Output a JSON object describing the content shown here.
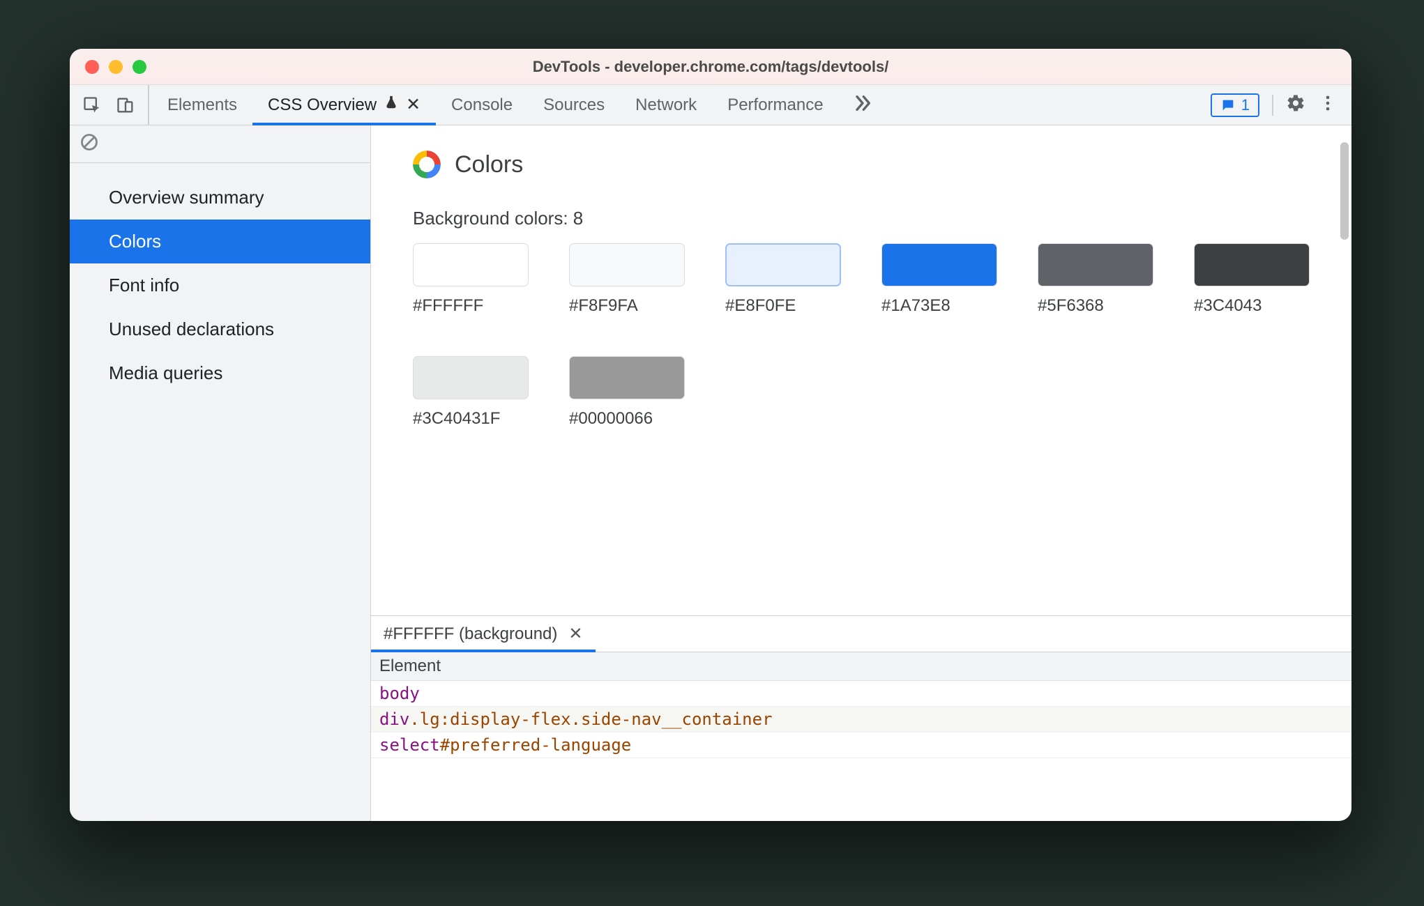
{
  "window_title": "DevTools - developer.chrome.com/tags/devtools/",
  "tabs": {
    "items": [
      "Elements",
      "CSS Overview",
      "Console",
      "Sources",
      "Network",
      "Performance"
    ],
    "active_index": 1,
    "experiment_on_index": 1,
    "close_on_active": true
  },
  "issues_count": "1",
  "sidebar": {
    "items": [
      "Overview summary",
      "Colors",
      "Font info",
      "Unused declarations",
      "Media queries"
    ],
    "selected_index": 1
  },
  "colors_section": {
    "title": "Colors",
    "background_label": "Background colors: 8",
    "swatches": [
      {
        "hex": "#FFFFFF",
        "fill": "#FFFFFF"
      },
      {
        "hex": "#F8F9FA",
        "fill": "#F8F9FA"
      },
      {
        "hex": "#E8F0FE",
        "fill": "#E8F0FE"
      },
      {
        "hex": "#1A73E8",
        "fill": "#1A73E8"
      },
      {
        "hex": "#5F6368",
        "fill": "#5F6368"
      },
      {
        "hex": "#3C4043",
        "fill": "#3C4043"
      },
      {
        "hex": "#3C40431F",
        "fill": "rgba(60,64,67,0.12)"
      },
      {
        "hex": "#00000066",
        "fill": "rgba(0,0,0,0.4)"
      }
    ]
  },
  "details": {
    "tab_label": "#FFFFFF (background)",
    "header": "Element",
    "rows": [
      [
        {
          "t": "tag",
          "v": "body"
        }
      ],
      [
        {
          "t": "tag",
          "v": "div"
        },
        {
          "t": "cls",
          "v": ".lg:display-flex"
        },
        {
          "t": "cls",
          "v": ".side-nav__container"
        }
      ],
      [
        {
          "t": "tag",
          "v": "select"
        },
        {
          "t": "id",
          "v": "#preferred-language"
        }
      ]
    ]
  }
}
